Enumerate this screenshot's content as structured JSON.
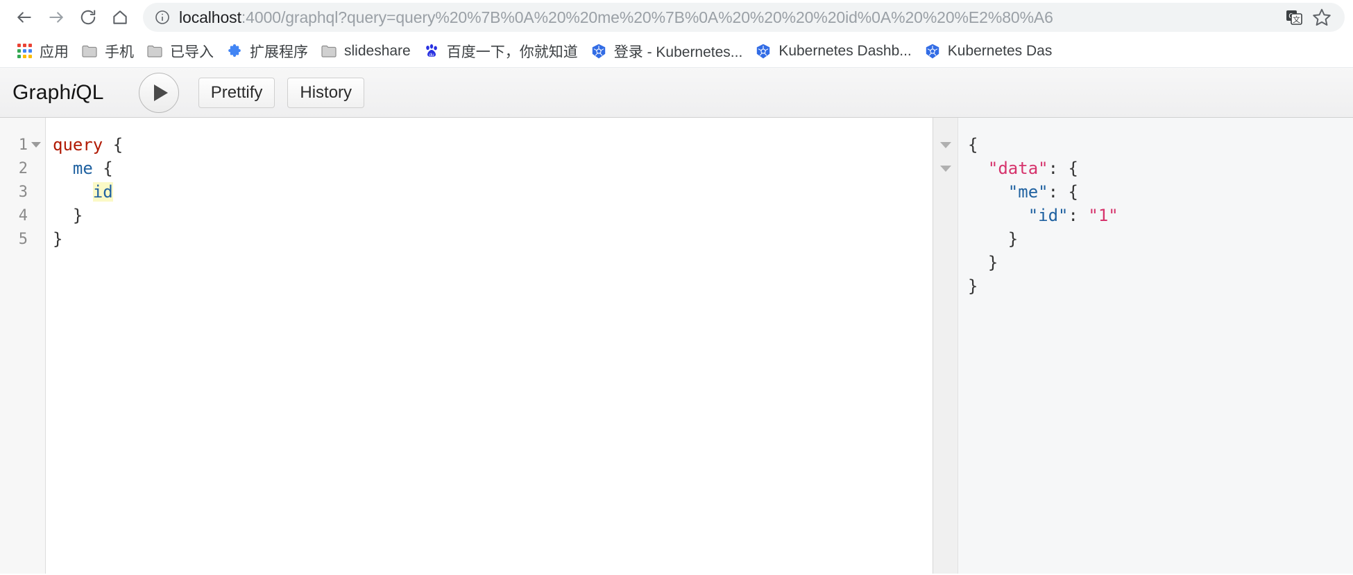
{
  "browser": {
    "nav": {
      "back_label": "Back",
      "forward_label": "Forward",
      "reload_label": "Reload",
      "home_label": "Home"
    },
    "omnibox": {
      "security_icon": "info-circle-icon",
      "host": "localhost",
      "path": ":4000/graphql?query=query%20%7B%0A%20%20me%20%7B%0A%20%20%20%20id%0A%20%20%E2%80%A6",
      "full_url": "localhost:4000/graphql?query=query%20%7B%0A%20%20me%20%7B%0A%20%20%20%20id%0A%20%20%20%E2%80%A6",
      "translate_icon": "translate-icon",
      "bookmark_star_icon": "star-icon"
    },
    "bookmarks": [
      {
        "label": "应用",
        "icon": "apps-grid-icon"
      },
      {
        "label": "手机",
        "icon": "folder-icon"
      },
      {
        "label": "已导入",
        "icon": "folder-icon"
      },
      {
        "label": "扩展程序",
        "icon": "puzzle-piece-icon"
      },
      {
        "label": "slideshare",
        "icon": "folder-icon"
      },
      {
        "label": "百度一下，你就知道",
        "icon": "baidu-paw-icon"
      },
      {
        "label": "登录 - Kubernetes...",
        "icon": "kubernetes-icon"
      },
      {
        "label": "Kubernetes Dashb...",
        "icon": "kubernetes-icon"
      },
      {
        "label": "Kubernetes Das",
        "icon": "kubernetes-icon"
      }
    ]
  },
  "graphiql": {
    "logo_pre": "Graph",
    "logo_i": "i",
    "logo_post": "QL",
    "execute_label": "Execute Query",
    "prettify_label": "Prettify",
    "history_label": "History",
    "editor": {
      "line_numbers": [
        "1",
        "2",
        "3",
        "4",
        "5"
      ],
      "fold_rows": [
        true,
        false,
        false,
        false,
        false
      ],
      "lines": [
        {
          "indent": 0,
          "tokens": [
            {
              "text": "query",
              "type": "kw"
            },
            {
              "text": " {",
              "type": "punc"
            }
          ]
        },
        {
          "indent": 0,
          "tokens": [
            {
              "text": "  ",
              "type": "punc"
            },
            {
              "text": "me",
              "type": "field"
            },
            {
              "text": " {",
              "type": "punc"
            }
          ]
        },
        {
          "indent": 0,
          "tokens": [
            {
              "text": "    ",
              "type": "punc"
            },
            {
              "text": "id",
              "type": "field-highlight"
            }
          ]
        },
        {
          "indent": 0,
          "tokens": [
            {
              "text": "  }",
              "type": "punc"
            }
          ]
        },
        {
          "indent": 0,
          "tokens": [
            {
              "text": "}",
              "type": "punc"
            }
          ]
        }
      ],
      "raw_text": "query {\n  me {\n    id\n  }\n}"
    },
    "result": {
      "fold_rows": [
        true,
        true,
        false,
        false,
        false,
        false,
        false
      ],
      "lines": [
        {
          "tokens": [
            {
              "text": "{",
              "type": "punc"
            }
          ]
        },
        {
          "tokens": [
            {
              "text": "  ",
              "type": "punc"
            },
            {
              "text": "\"data\"",
              "type": "key-data"
            },
            {
              "text": ": {",
              "type": "punc"
            }
          ]
        },
        {
          "tokens": [
            {
              "text": "    ",
              "type": "punc"
            },
            {
              "text": "\"me\"",
              "type": "key"
            },
            {
              "text": ": {",
              "type": "punc"
            }
          ]
        },
        {
          "tokens": [
            {
              "text": "      ",
              "type": "punc"
            },
            {
              "text": "\"id\"",
              "type": "key"
            },
            {
              "text": ": ",
              "type": "punc"
            },
            {
              "text": "\"1\"",
              "type": "str"
            }
          ]
        },
        {
          "tokens": [
            {
              "text": "    }",
              "type": "punc"
            }
          ]
        },
        {
          "tokens": [
            {
              "text": "  }",
              "type": "punc"
            }
          ]
        },
        {
          "tokens": [
            {
              "text": "}",
              "type": "punc"
            }
          ]
        }
      ],
      "raw_json": "{\n  \"data\": {\n    \"me\": {\n      \"id\": \"1\"\n    }\n  }\n}"
    }
  },
  "colors": {
    "keyword": "#b11a04",
    "field": "#1f61a0",
    "highlight": "#fbf9c6",
    "json_string": "#d6336c",
    "kubernetes_blue": "#326ce5",
    "baidu_blue": "#2932e1",
    "extension_blue": "#4285f4"
  }
}
